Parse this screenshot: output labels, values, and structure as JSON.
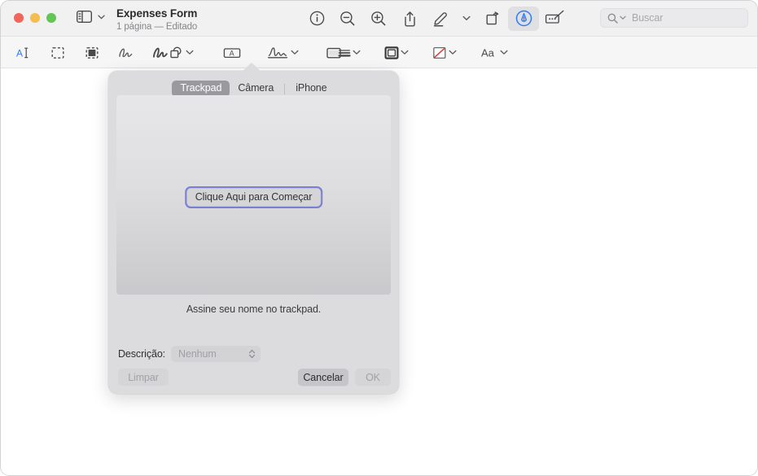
{
  "window": {
    "traffic_lights": [
      "close",
      "minimize",
      "zoom"
    ],
    "colors": {
      "close": "#f2655a",
      "minimize": "#f5bd4f",
      "zoom": "#62c554",
      "accent_blue": "#2e7cf6",
      "focus_ring": "#7b7fd4",
      "titlebar_bg": "#f1f1f2",
      "markupbar_bg": "#f6f6f7",
      "popover_bg": "#dcdcde"
    }
  },
  "titlebar": {
    "sidebar_toggle_label": "sidebar-toggle",
    "document_title": "Expenses Form",
    "document_subtitle": "1 página — Editado",
    "tools": [
      {
        "name": "info-icon",
        "tooltip": "Info"
      },
      {
        "name": "zoom-out-icon",
        "tooltip": "Reduzir"
      },
      {
        "name": "zoom-in-icon",
        "tooltip": "Ampliar"
      },
      {
        "name": "share-icon",
        "tooltip": "Compartilhar"
      },
      {
        "name": "highlight-pen-icon",
        "tooltip": "Destacar"
      },
      {
        "name": "chevron-down-icon",
        "tooltip": "Opções de destaque"
      },
      {
        "name": "rotate-icon",
        "tooltip": "Girar"
      },
      {
        "name": "markup-icon",
        "tooltip": "Marcação",
        "active": true
      },
      {
        "name": "annotate-icon",
        "tooltip": "Anotar"
      }
    ],
    "search": {
      "placeholder": "Buscar",
      "icon": "search-icon",
      "chevron": "chevron-down-icon"
    }
  },
  "markup_toolbar": {
    "left_tools": [
      {
        "name": "text-selection-icon",
        "label": "Seleção de texto"
      },
      {
        "name": "rectangular-selection-icon",
        "label": "Seleção retangular"
      },
      {
        "name": "instant-alpha-icon",
        "label": "Alfa instantâneo"
      },
      {
        "name": "sketch-icon",
        "label": "Esboço"
      },
      {
        "name": "draw-icon",
        "label": "Desenhar"
      }
    ],
    "mid_tools": [
      {
        "name": "shapes-icon",
        "label": "Formas",
        "has_chevron": true
      },
      {
        "name": "text-box-icon",
        "label": "Texto"
      },
      {
        "name": "signature-icon",
        "label": "Assinar",
        "has_chevron": true,
        "active": true
      },
      {
        "name": "note-icon",
        "label": "Nota"
      }
    ],
    "right_tools": [
      {
        "name": "shape-style-icon",
        "label": "Estilo da forma",
        "has_chevron": true
      },
      {
        "name": "border-style-icon",
        "label": "Estilo da borda",
        "has_chevron": true
      },
      {
        "name": "fill-color-icon",
        "label": "Cor de preenchimento",
        "has_chevron": true
      },
      {
        "name": "font-style-icon",
        "label": "Aa",
        "has_chevron": true
      }
    ]
  },
  "signature_popover": {
    "tabs": [
      {
        "label": "Trackpad",
        "selected": true
      },
      {
        "label": "Câmera",
        "selected": false
      },
      {
        "label": "iPhone",
        "selected": false
      }
    ],
    "start_button_label": "Clique Aqui para Começar",
    "hint_text": "Assine seu nome no trackpad.",
    "description_label": "Descrição:",
    "description_value": "Nenhum",
    "description_options": [
      "Nenhum"
    ],
    "buttons": {
      "clear": {
        "label": "Limpar",
        "enabled": false
      },
      "cancel": {
        "label": "Cancelar",
        "enabled": true
      },
      "ok": {
        "label": "OK",
        "enabled": false
      }
    }
  }
}
